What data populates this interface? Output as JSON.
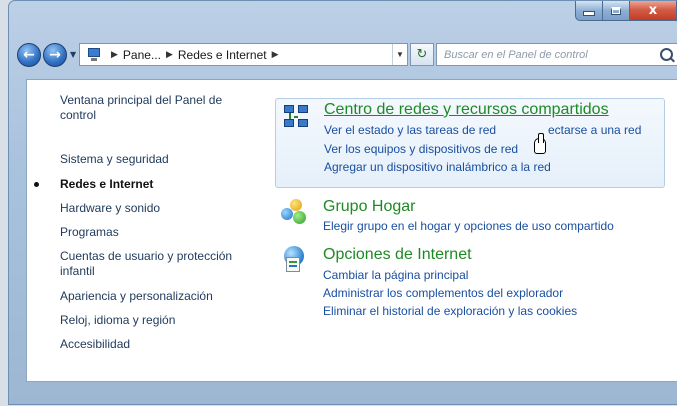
{
  "window": {
    "caption_buttons": {
      "minimize_icon": "minimize-icon",
      "maximize_icon": "maximize-icon",
      "close_label": "x"
    }
  },
  "navbar": {
    "back_icon": "arrow-left-icon",
    "forward_icon": "arrow-right-icon",
    "breadcrumbs": [
      "Pane...",
      "Redes e Internet"
    ],
    "search_placeholder": "Buscar en el Panel de control"
  },
  "sidebar": {
    "items": [
      {
        "label": "Ventana principal del Panel de control",
        "current": false
      },
      {
        "label": "Sistema y seguridad",
        "current": false
      },
      {
        "label": "Redes e Internet",
        "current": true
      },
      {
        "label": "Hardware y sonido",
        "current": false
      },
      {
        "label": "Programas",
        "current": false
      },
      {
        "label": "Cuentas de usuario y protección infantil",
        "current": false
      },
      {
        "label": "Apariencia y personalización",
        "current": false
      },
      {
        "label": "Reloj, idioma y región",
        "current": false
      },
      {
        "label": "Accesibilidad",
        "current": false
      }
    ]
  },
  "categories": [
    {
      "title": "Centro de redes y recursos compartidos",
      "icon": "network-icon",
      "links": [
        "Ver el estado y las tareas de red",
        "ectarse a una red",
        "Ver los equipos y dispositivos de red",
        "Agregar un dispositivo inalámbrico a la red"
      ]
    },
    {
      "title": "Grupo Hogar",
      "icon": "homegroup-icon",
      "links": [
        "Elegir grupo en el hogar y opciones de uso compartido"
      ]
    },
    {
      "title": "Opciones de Internet",
      "icon": "internet-options-icon",
      "links": [
        "Cambiar la página principal",
        "Administrar los complementos del explorador",
        "Eliminar el historial de exploración y las cookies"
      ]
    }
  ],
  "colors": {
    "link": "#1a4fa0",
    "category_title": "#1e8a25",
    "sidebar_text": "#1e395b",
    "window_frame": "#a9c2dd",
    "close_button": "#c33c24"
  }
}
